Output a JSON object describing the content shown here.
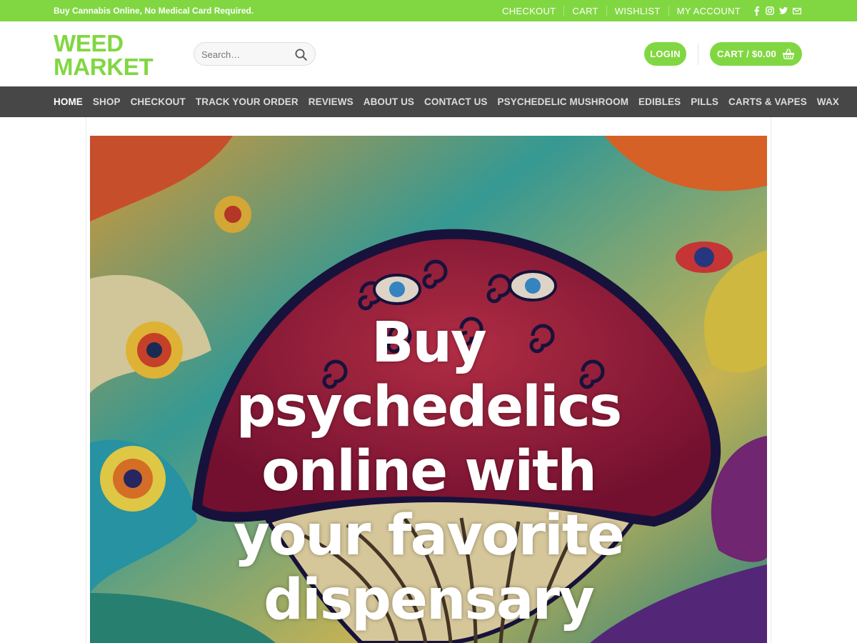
{
  "topbar": {
    "tagline": "Buy Cannabis Online, No Medical Card Required.",
    "links": [
      "CHECKOUT",
      "CART",
      "WISHLIST",
      "MY ACCOUNT"
    ],
    "social_icons": [
      "facebook-icon",
      "instagram-icon",
      "twitter-icon",
      "email-icon"
    ]
  },
  "header": {
    "logo_line1": "WEED",
    "logo_line2": "MARKET",
    "search_placeholder": "Search…",
    "login_label": "LOGIN",
    "cart_label": "CART / $0.00",
    "cart_icon": "shopping-basket-icon"
  },
  "nav": {
    "items": [
      "HOME",
      "SHOP",
      "CHECKOUT",
      "TRACK YOUR ORDER",
      "REVIEWS",
      "ABOUT US",
      "CONTACT US",
      "PSYCHEDELIC MUSHROOM",
      "EDIBLES",
      "PILLS",
      "CARTS & VAPES",
      "WAX"
    ],
    "active": "HOME"
  },
  "hero": {
    "line1": "Buy",
    "line2": "psychedelics",
    "line3": "online with",
    "line4": "your favorite",
    "line5": "dispensary"
  },
  "colors": {
    "brand_green": "#81d742",
    "nav_bg": "#474747"
  }
}
